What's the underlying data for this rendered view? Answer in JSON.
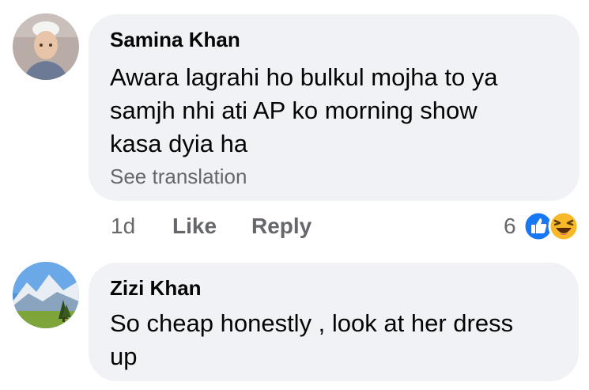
{
  "comments": [
    {
      "author": "Samina Khan",
      "text_lines": [
        "Awara lagrahi ho bulkul mojha to ya",
        "samjh nhi ati AP ko morning show",
        "kasa dyia ha"
      ],
      "see_translation": "See translation",
      "time": "1d",
      "like_label": "Like",
      "reply_label": "Reply",
      "reaction_count": "6",
      "reaction_icons": [
        "like-icon",
        "haha-icon"
      ]
    },
    {
      "author": "Zizi Khan",
      "text_lines": [
        "So cheap honestly , look at her dress",
        "up"
      ]
    }
  ],
  "colors": {
    "bubble": "#f0f2f5",
    "secondary_text": "#65676b",
    "like_blue": "#1877f2",
    "haha_yellow": "#f7b928"
  }
}
